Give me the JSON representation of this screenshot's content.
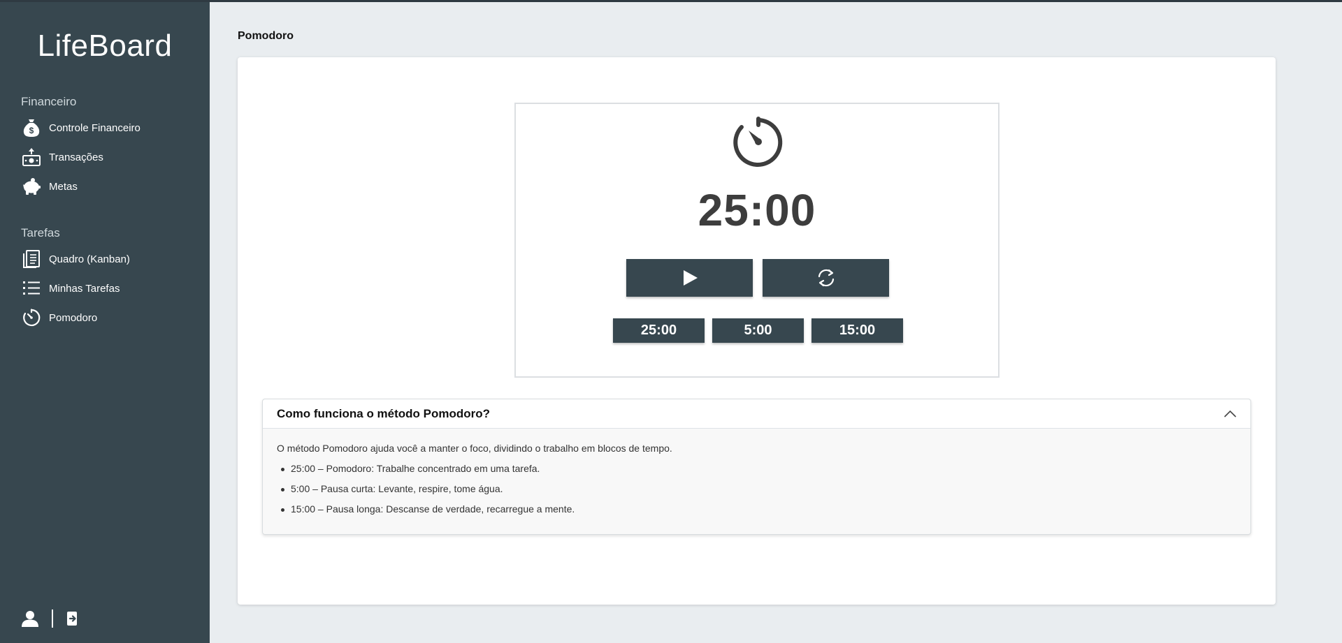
{
  "app": {
    "brand": "LifeBoard"
  },
  "sidebar": {
    "sections": [
      {
        "title": "Financeiro",
        "items": [
          {
            "label": "Controle Financeiro",
            "icon": "money-bag-icon"
          },
          {
            "label": "Transações",
            "icon": "cash-transfer-icon"
          },
          {
            "label": "Metas",
            "icon": "piggy-bank-icon"
          }
        ]
      },
      {
        "title": "Tarefas",
        "items": [
          {
            "label": "Quadro (Kanban)",
            "icon": "kanban-board-icon"
          },
          {
            "label": "Minhas Tarefas",
            "icon": "list-icon"
          },
          {
            "label": "Pomodoro",
            "icon": "timer-icon"
          }
        ]
      }
    ],
    "footer": {
      "profile_icon": "user-icon",
      "logout_icon": "logout-icon"
    }
  },
  "page": {
    "title": "Pomodoro"
  },
  "timer": {
    "display": "25:00",
    "controls": {
      "play_icon": "play-icon",
      "reset_icon": "reset-icon"
    },
    "presets": [
      "25:00",
      "5:00",
      "15:00"
    ]
  },
  "info": {
    "title": "Como funciona o método Pomodoro?",
    "intro": "O método Pomodoro ajuda você a manter o foco, dividindo o trabalho em blocos de tempo.",
    "items": [
      "25:00 – Pomodoro: Trabalhe concentrado em uma tarefa.",
      "5:00 – Pausa curta: Levante, respire, tome água.",
      "15:00 – Pausa longa: Descanse de verdade, recarregue a mente."
    ],
    "expanded": true
  },
  "colors": {
    "sidebar": "#37474f",
    "background": "#e9edf0",
    "button": "#37474f",
    "timer_text": "#3d3d3d"
  }
}
